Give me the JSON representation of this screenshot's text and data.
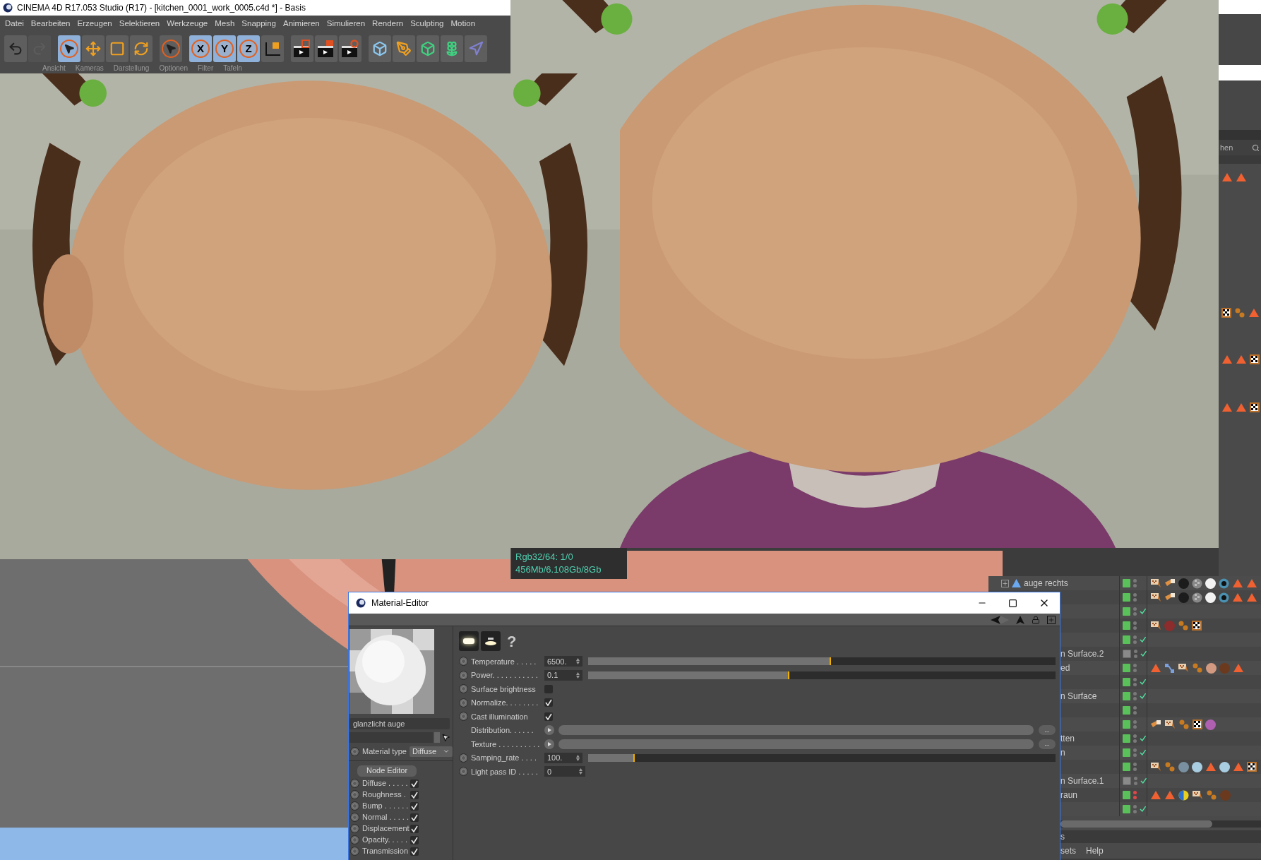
{
  "window": {
    "title": "CINEMA 4D R17.053 Studio (R17) - [kitchen_0001_work_0005.c4d *] - Basis"
  },
  "menu": [
    "Datei",
    "Bearbeiten",
    "Erzeugen",
    "Selektieren",
    "Werkzeuge",
    "Mesh",
    "Snapping",
    "Animieren",
    "Simulieren",
    "Rendern",
    "Sculpting",
    "Motion"
  ],
  "toolbar": [
    {
      "items": [
        {
          "kind": "undo",
          "selected": false,
          "disabled": false
        },
        {
          "kind": "redo",
          "selected": false,
          "disabled": true
        }
      ]
    },
    {
      "items": [
        {
          "kind": "select",
          "selected": true,
          "disabled": false
        },
        {
          "kind": "move",
          "selected": false,
          "disabled": false
        },
        {
          "kind": "scale",
          "selected": false,
          "disabled": false
        },
        {
          "kind": "rotate",
          "selected": false,
          "disabled": false
        }
      ]
    },
    {
      "items": [
        {
          "kind": "select",
          "selected": false,
          "disabled": false
        }
      ]
    },
    {
      "items": [
        {
          "kind": "axis",
          "label": "X",
          "selected": true,
          "disabled": false
        },
        {
          "kind": "axis",
          "label": "Y",
          "selected": true,
          "disabled": false
        },
        {
          "kind": "axis",
          "label": "Z",
          "selected": true,
          "disabled": false
        },
        {
          "kind": "coords",
          "selected": false,
          "disabled": false
        }
      ]
    },
    {
      "items": [
        {
          "kind": "render-view",
          "selected": false,
          "disabled": false
        },
        {
          "kind": "render",
          "selected": false,
          "disabled": false
        },
        {
          "kind": "render-settings",
          "selected": false,
          "disabled": false
        }
      ]
    },
    {
      "items": [
        {
          "kind": "cube",
          "selected": false,
          "disabled": false
        },
        {
          "kind": "pen",
          "selected": false,
          "disabled": false
        },
        {
          "kind": "subdivision",
          "selected": false,
          "disabled": false
        },
        {
          "kind": "array",
          "selected": false,
          "disabled": false
        },
        {
          "kind": "deformer",
          "selected": false,
          "disabled": false
        }
      ]
    }
  ],
  "viewport_menu": [
    "Ansicht",
    "Kameras",
    "Darstellung",
    "Optionen",
    "Filter",
    "Tafeln"
  ],
  "render_stats": [
    "Rgb32/64: 1/0",
    "456Mb/6.108Gb/8Gb"
  ],
  "material_editor": {
    "title": "Material-Editor",
    "name": "glanzlicht auge",
    "material_type": {
      "label": "Material type",
      "value": "Diffuse"
    },
    "node_editor": "Node Editor",
    "channels": [
      {
        "label": "Diffuse . . . . .",
        "checked": true
      },
      {
        "label": "Roughness .",
        "checked": true
      },
      {
        "label": "Bump . . . . . .",
        "checked": true
      },
      {
        "label": "Normal . . . . .",
        "checked": true
      },
      {
        "label": "Displacement",
        "checked": true
      },
      {
        "label": "Opacity. . . . .",
        "checked": true
      },
      {
        "label": "Transmission",
        "checked": true
      }
    ],
    "help": "?",
    "params": [
      {
        "kind": "slider",
        "label": "Temperature . . . . .",
        "value": "6500.",
        "level": 0.52
      },
      {
        "kind": "slider",
        "label": "Power. . . . . . . . . . .",
        "value": "0.1",
        "level": 0.43
      },
      {
        "kind": "checkbox",
        "label": "Surface brightness",
        "checked": false
      },
      {
        "kind": "checkbox",
        "label": "Normalize. . . . . . . .",
        "checked": true
      },
      {
        "kind": "checkbox",
        "label": "Cast illumination",
        "checked": true
      },
      {
        "kind": "link",
        "label": "Distribution. . . . . .",
        "button": "..."
      },
      {
        "kind": "link",
        "label": "Texture . . . . . . . . . .",
        "button": "..."
      },
      {
        "kind": "slider",
        "label": "Samping_rate . . . .",
        "value": "100.",
        "level": 0.1
      },
      {
        "kind": "number",
        "label": "Light pass ID . . . . .",
        "value": "0"
      }
    ]
  },
  "object_manager": {
    "rows": [
      {
        "kind": "object",
        "label": "auge rechts",
        "layer_on": true,
        "hidden": false,
        "checked": false,
        "tags": [
          {
            "kind": "bones"
          },
          {
            "kind": "pins"
          },
          {
            "kind": "sphere",
            "color": "#1c1c1c"
          },
          {
            "kind": "checker-sphere"
          },
          {
            "kind": "sphere",
            "color": "#f2f2f2"
          },
          {
            "kind": "eye"
          },
          {
            "kind": "triangle"
          },
          {
            "kind": "triangle"
          }
        ]
      },
      {
        "kind": "partial",
        "layer_on": true,
        "hidden": false,
        "checked": false,
        "tags": [
          {
            "kind": "bones"
          },
          {
            "kind": "pins"
          },
          {
            "kind": "sphere",
            "color": "#1c1c1c"
          },
          {
            "kind": "checker-sphere"
          },
          {
            "kind": "sphere",
            "color": "#f2f2f2"
          },
          {
            "kind": "eye"
          },
          {
            "kind": "triangle"
          },
          {
            "kind": "triangle"
          }
        ]
      },
      {
        "kind": "partial",
        "layer_on": true,
        "hidden": false,
        "checked": true
      },
      {
        "kind": "partial",
        "layer_on": true,
        "hidden": false,
        "checked": false,
        "tags": [
          {
            "kind": "bones"
          },
          {
            "kind": "sphere",
            "color": "#8c2c2c"
          },
          {
            "kind": "dots"
          },
          {
            "kind": "checker"
          }
        ]
      },
      {
        "kind": "partial",
        "layer_on": true,
        "hidden": false,
        "checked": true
      },
      {
        "kind": "partial",
        "label": "n Surface.2",
        "layer_on": false,
        "hidden": false,
        "checked": true
      },
      {
        "kind": "partial",
        "label": "ed",
        "layer_on": true,
        "hidden": false,
        "checked": false,
        "tags": [
          {
            "kind": "triangle"
          },
          {
            "kind": "nodes"
          },
          {
            "kind": "bones"
          },
          {
            "kind": "dots"
          },
          {
            "kind": "sphere",
            "color": "#d29a80"
          },
          {
            "kind": "sphere",
            "color": "#6b3a1e"
          },
          {
            "kind": "triangle"
          }
        ]
      },
      {
        "kind": "partial",
        "layer_on": true,
        "hidden": false,
        "checked": true
      },
      {
        "kind": "partial",
        "label": "n Surface",
        "layer_on": true,
        "hidden": false,
        "checked": true
      },
      {
        "kind": "partial",
        "layer_on": true,
        "hidden": false,
        "checked": false
      },
      {
        "kind": "partial",
        "layer_on": true,
        "hidden": false,
        "checked": false,
        "tags": [
          {
            "kind": "pins"
          },
          {
            "kind": "bones"
          },
          {
            "kind": "dots"
          },
          {
            "kind": "checker"
          },
          {
            "kind": "sphere",
            "color": "#b060b0"
          }
        ]
      },
      {
        "kind": "partial",
        "label": "tten",
        "layer_on": true,
        "hidden": false,
        "checked": true
      },
      {
        "kind": "partial",
        "label": "n",
        "layer_on": true,
        "hidden": false,
        "checked": true
      },
      {
        "kind": "partial",
        "layer_on": true,
        "hidden": false,
        "checked": false,
        "tags": [
          {
            "kind": "bones"
          },
          {
            "kind": "dots"
          },
          {
            "kind": "sphere",
            "color": "#7890a0"
          },
          {
            "kind": "sphere",
            "color": "#a8cce0"
          },
          {
            "kind": "triangle"
          },
          {
            "kind": "sphere",
            "color": "#a8cce0"
          },
          {
            "kind": "triangle"
          },
          {
            "kind": "checker"
          }
        ]
      },
      {
        "kind": "partial",
        "label": "n Surface.1",
        "layer_on": false,
        "hidden": false,
        "checked": true
      },
      {
        "kind": "partial",
        "label": "raun",
        "layer_on": true,
        "hidden": true,
        "checked": false,
        "tags": [
          {
            "kind": "triangle"
          },
          {
            "kind": "triangle"
          },
          {
            "kind": "ball"
          },
          {
            "kind": "bones"
          },
          {
            "kind": "dots"
          },
          {
            "kind": "sphere",
            "color": "#6b3a1e"
          }
        ]
      },
      {
        "kind": "partial",
        "layer_on": true,
        "hidden": false,
        "checked": true
      }
    ],
    "tab": "s",
    "menu": [
      "sets",
      "Help"
    ]
  },
  "side_panel": {
    "search": "hen",
    "rows": [
      {
        "tags": [
          {
            "kind": "triangle"
          },
          {
            "kind": "triangle"
          }
        ]
      },
      {
        "tags": [
          {
            "kind": "checker"
          },
          {
            "kind": "dots"
          },
          {
            "kind": "triangle"
          }
        ]
      },
      {
        "tags": [
          {
            "kind": "triangle"
          },
          {
            "kind": "triangle"
          },
          {
            "kind": "checker"
          }
        ]
      },
      {
        "tags": [
          {
            "kind": "triangle"
          },
          {
            "kind": "triangle"
          },
          {
            "kind": "checker"
          }
        ]
      }
    ]
  }
}
